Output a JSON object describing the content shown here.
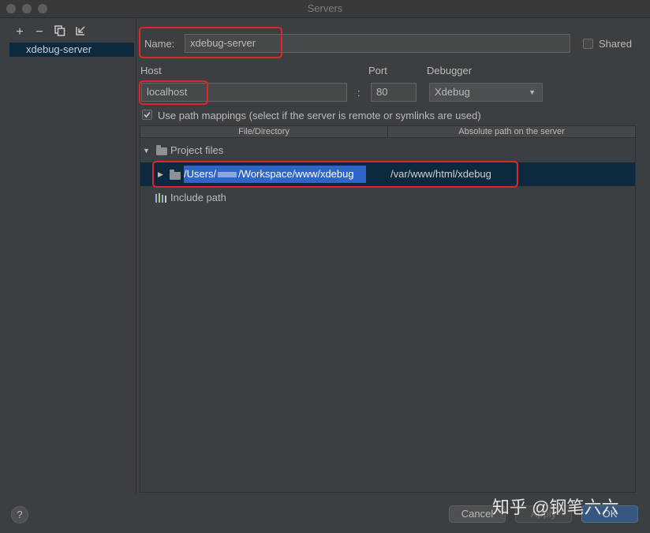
{
  "window": {
    "title": "Servers"
  },
  "sidebar": {
    "toolbar": {
      "add": "+",
      "remove": "−"
    },
    "servers": [
      {
        "label": "xdebug-server"
      }
    ]
  },
  "form": {
    "name_label": "Name:",
    "name_value": "xdebug-server",
    "shared_label": "Shared",
    "host_label": "Host",
    "host_value": "localhost",
    "port_label": "Port",
    "port_value": "80",
    "colon": ":",
    "debugger_label": "Debugger",
    "debugger_value": "Xdebug",
    "path_mapping_label": "Use path mappings (select if the server is remote or symlinks are used)"
  },
  "table": {
    "columns": [
      "File/Directory",
      "Absolute path on the server"
    ],
    "project_files_label": "Project files",
    "mapping": {
      "local_prefix": "/Users/",
      "local_suffix": "/Workspace/www/xdebug",
      "remote": "/var/www/html/xdebug"
    },
    "include_path_label": "Include path"
  },
  "footer": {
    "help": "?",
    "cancel": "Cancel",
    "apply": "Apply",
    "ok": "OK"
  },
  "watermark": "知乎 @钢笔六六"
}
